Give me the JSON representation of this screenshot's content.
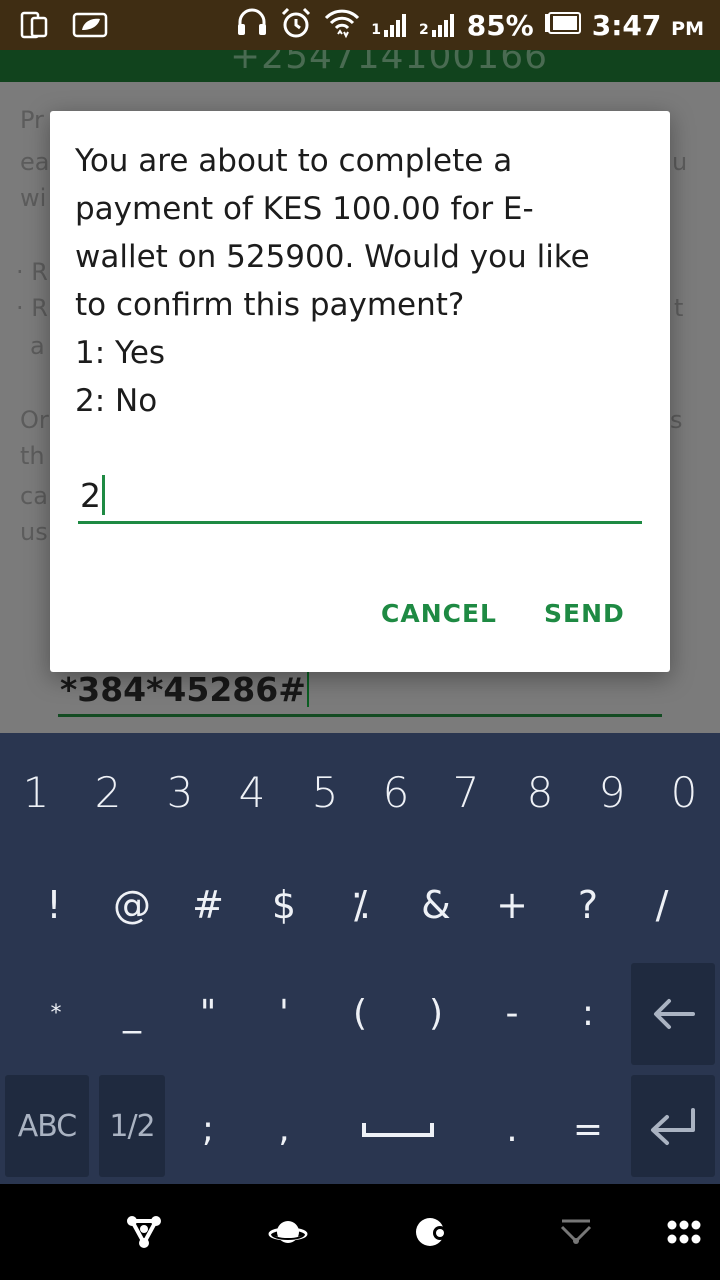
{
  "status_bar": {
    "battery_percent": "85%",
    "time": "3:47",
    "time_suffix": "PM",
    "sim1_label": "1",
    "sim2_label": "2",
    "icons": [
      "phone-outline-icon",
      "notification-icon",
      "headset-icon",
      "alarm-icon",
      "wifi-icon",
      "signal-sim1-icon",
      "signal-sim2-icon",
      "battery-icon"
    ]
  },
  "background_app": {
    "phone_number": "+254714100166",
    "ussd_input_value": "*384*45286#",
    "text_fragments": [
      "Pr",
      "ea",
      "wi",
      "u",
      "· R",
      "· R",
      "t",
      "a",
      "Or",
      "s",
      "th",
      "ca",
      "us"
    ]
  },
  "dialog": {
    "message_lines": [
      "You are about to complete a",
      "payment of KES 100.00 for E-",
      "wallet on 525900. Would you like",
      "to confirm this payment?",
      "1: Yes",
      "2: No"
    ],
    "input_value": "2",
    "cancel_label": "CANCEL",
    "send_label": "SEND"
  },
  "keyboard": {
    "row1": [
      "1",
      "2",
      "3",
      "4",
      "5",
      "6",
      "7",
      "8",
      "9",
      "0"
    ],
    "row2": [
      "!",
      "@",
      "#",
      "$",
      "⁒",
      "&",
      "+",
      "?",
      "/"
    ],
    "row3": [
      "*",
      "_",
      "\"",
      "'",
      "(",
      ")",
      "-",
      ":"
    ],
    "row4": [
      ";",
      ",",
      ".",
      "="
    ],
    "abc_label": "ABC",
    "page_label": "1/2",
    "icons": [
      "backspace-icon",
      "enter-icon",
      "space-icon"
    ]
  },
  "nav_bar": {
    "icons": [
      "share-nodes-icon",
      "planet-icon",
      "moon-icon",
      "swipe-down-icon",
      "grid-dots-icon"
    ]
  },
  "colors": {
    "status_bar_bg": "#3f2d13",
    "accent_green": "#1e8a43",
    "keyboard_bg": "#2a3650",
    "dialog_bg": "#ffffff"
  }
}
